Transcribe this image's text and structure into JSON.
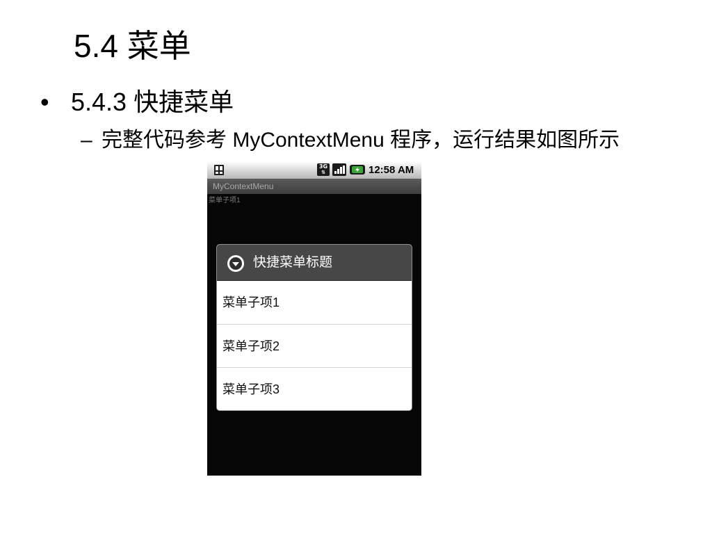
{
  "slide": {
    "title": "5.4  菜单",
    "bullet1": {
      "marker": "•",
      "text": "5.4.3  快捷菜单"
    },
    "bullet2": {
      "marker": "–",
      "text": "完整代码参考 MyContextMenu 程序，运行结果如图所示"
    }
  },
  "phone": {
    "status_bar": {
      "network_label": "3G",
      "time": "12:58 AM",
      "icons": [
        "sim-icon",
        "network-3g-icon",
        "signal-strength-icon",
        "battery-charging-icon"
      ]
    },
    "app_title": "MyContextMenu",
    "background_item": "菜单子项1",
    "context_menu": {
      "title": "快捷菜单标题",
      "title_icon": "context-menu-icon",
      "items": [
        {
          "label": "菜单子项1"
        },
        {
          "label": "菜单子项2"
        },
        {
          "label": "菜单子项3"
        }
      ]
    }
  },
  "colors": {
    "dialog_header": "#474747",
    "phone_background": "#060606",
    "battery_green": "#3aa63a"
  }
}
